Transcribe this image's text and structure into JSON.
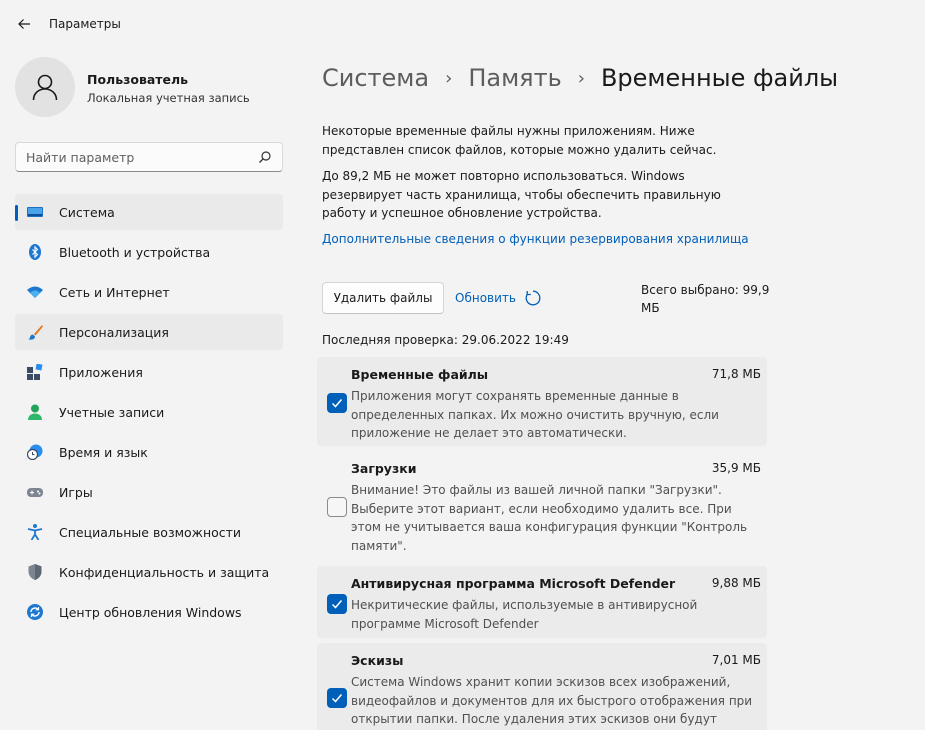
{
  "window": {
    "title": "Параметры"
  },
  "profile": {
    "name": "Пользователь",
    "account_type": "Локальная учетная запись"
  },
  "search": {
    "placeholder": "Найти параметр"
  },
  "sidebar": {
    "items": [
      {
        "label": "Система",
        "icon": "system-icon",
        "active": true
      },
      {
        "label": "Bluetooth и устройства",
        "icon": "bluetooth-icon"
      },
      {
        "label": "Сеть и Интернет",
        "icon": "wifi-icon"
      },
      {
        "label": "Персонализация",
        "icon": "brush-icon"
      },
      {
        "label": "Приложения",
        "icon": "apps-icon"
      },
      {
        "label": "Учетные записи",
        "icon": "account-icon"
      },
      {
        "label": "Время и язык",
        "icon": "clock-globe-icon"
      },
      {
        "label": "Игры",
        "icon": "gamepad-icon"
      },
      {
        "label": "Специальные возможности",
        "icon": "accessibility-icon"
      },
      {
        "label": "Конфиденциальность и защита",
        "icon": "shield-icon"
      },
      {
        "label": "Центр обновления Windows",
        "icon": "update-icon"
      }
    ]
  },
  "breadcrumb": [
    "Система",
    "Память",
    "Временные файлы"
  ],
  "main": {
    "description_1": "Некоторые временные файлы нужны приложениям. Ниже представлен список файлов, которые можно удалить сейчас.",
    "description_2": "До 89,2 МБ не может повторно использоваться. Windows резервирует часть хранилища, чтобы обеспечить правильную работу и успешное обновление устройства.",
    "link": "Дополнительные сведения о функции резервирования хранилища",
    "delete_button": "Удалить файлы",
    "refresh_button": "Обновить",
    "total_selected": "Всего выбрано: 99,9 МБ",
    "last_check": "Последняя проверка: 29.06.2022 19:49"
  },
  "files": [
    {
      "title": "Временные файлы",
      "size": "71,8 МБ",
      "checked": true,
      "description": "Приложения могут сохранять временные данные в определенных папках. Их можно очистить вручную, если приложение не делает это автоматически."
    },
    {
      "title": "Загрузки",
      "size": "35,9 МБ",
      "checked": false,
      "description": "Внимание! Это файлы из вашей личной папки \"Загрузки\". Выберите этот вариант, если необходимо удалить все. При этом не учитывается ваша конфигурация функции \"Контроль памяти\"."
    },
    {
      "title": "Антивирусная программа Microsoft Defender",
      "size": "9,88 МБ",
      "checked": true,
      "description": "Некритические файлы, используемые в антивирусной программе Microsoft Defender"
    },
    {
      "title": "Эскизы",
      "size": "7,01 МБ",
      "checked": true,
      "description": "Система Windows хранит копии эскизов всех изображений, видеофайлов и документов для их быстрого отображения при открытии папки. После удаления этих эскизов они будут"
    }
  ],
  "colors": {
    "accent": "#005fb8",
    "background": "#f3f3f3",
    "card": "#ebebeb"
  }
}
